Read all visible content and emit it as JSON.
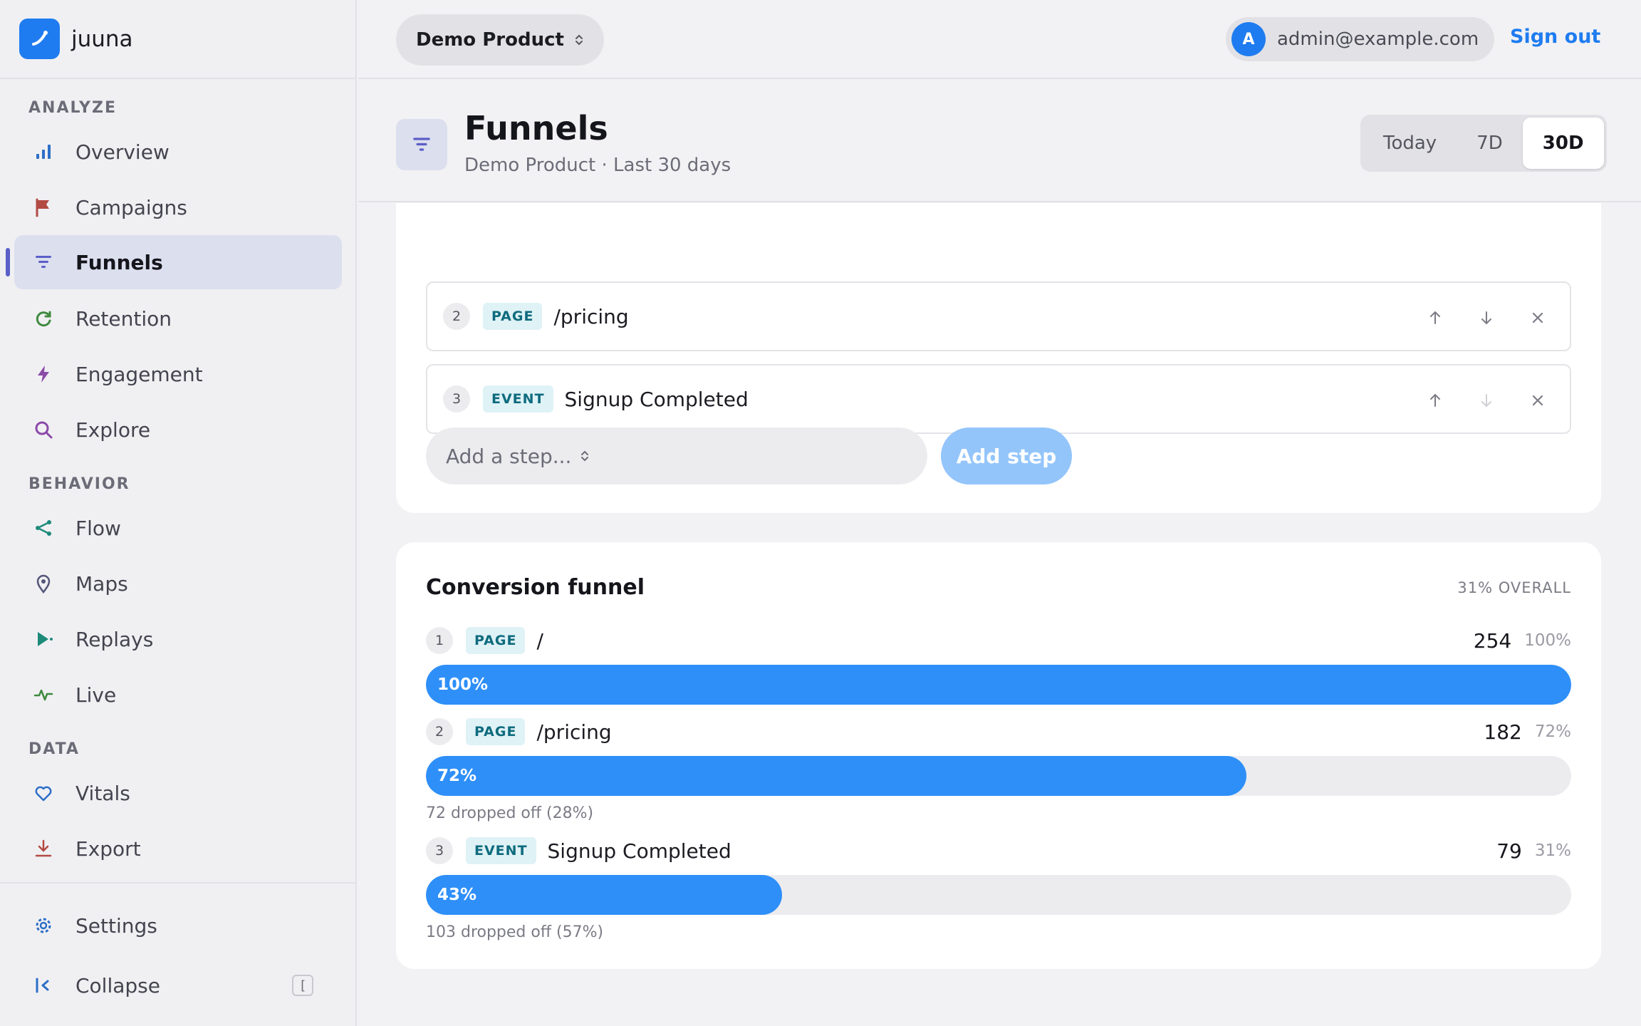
{
  "brand": {
    "name": "juuna"
  },
  "sidebar": {
    "sections": [
      {
        "title": "ANALYZE"
      },
      {
        "title": "BEHAVIOR"
      },
      {
        "title": "DATA"
      }
    ],
    "items": [
      {
        "label": "Overview",
        "icon": "bar-chart-icon",
        "color": "#2e6fc7"
      },
      {
        "label": "Campaigns",
        "icon": "flag-icon",
        "color": "#b24a43"
      },
      {
        "label": "Funnels",
        "icon": "funnel-icon",
        "color": "#5b5fc7",
        "active": true
      },
      {
        "label": "Retention",
        "icon": "refresh-icon",
        "color": "#3f8a3f"
      },
      {
        "label": "Engagement",
        "icon": "bolt-icon",
        "color": "#8a4aa8"
      },
      {
        "label": "Explore",
        "icon": "search-icon",
        "color": "#8a4aa8"
      },
      {
        "label": "Flow",
        "icon": "share-icon",
        "color": "#1d8a7a"
      },
      {
        "label": "Maps",
        "icon": "pin-icon",
        "color": "#55557a"
      },
      {
        "label": "Replays",
        "icon": "play-icon",
        "color": "#1d8a7a"
      },
      {
        "label": "Live",
        "icon": "pulse-icon",
        "color": "#3f8a3f"
      },
      {
        "label": "Vitals",
        "icon": "heart-icon",
        "color": "#2e6fc7"
      },
      {
        "label": "Export",
        "icon": "download-icon",
        "color": "#b24a43"
      }
    ],
    "settings_label": "Settings",
    "collapse_label": "Collapse",
    "collapse_shortcut": "["
  },
  "topbar": {
    "product": "Demo Product",
    "user_initial": "A",
    "user_email": "admin@example.com",
    "signout_label": "Sign out"
  },
  "header": {
    "title": "Funnels",
    "subtitle": "Demo Product · Last 30 days",
    "ranges": [
      {
        "label": "Today"
      },
      {
        "label": "7D"
      },
      {
        "label": "30D",
        "active": true
      }
    ]
  },
  "steps": [
    {
      "num": "1",
      "type": "PAGE",
      "name": "/"
    },
    {
      "num": "2",
      "type": "PAGE",
      "name": "/pricing"
    },
    {
      "num": "3",
      "type": "EVENT",
      "name": "Signup Completed"
    }
  ],
  "add_step": {
    "placeholder": "Add a step...",
    "button_label": "Add step"
  },
  "funnel": {
    "title": "Conversion funnel",
    "overall": "31% OVERALL",
    "steps": [
      {
        "num": "1",
        "type": "PAGE",
        "name": "/",
        "count": "254",
        "pct": "100%",
        "bar_label": "100%",
        "bar_fraction": 1.0,
        "dropped": ""
      },
      {
        "num": "2",
        "type": "PAGE",
        "name": "/pricing",
        "count": "182",
        "pct": "72%",
        "bar_label": "72%",
        "bar_fraction": 0.7165,
        "dropped": "72 dropped off (28%)"
      },
      {
        "num": "3",
        "type": "EVENT",
        "name": "Signup Completed",
        "count": "79",
        "pct": "31%",
        "bar_label": "43%",
        "bar_fraction": 0.311,
        "dropped": "103 dropped off (57%)"
      }
    ]
  }
}
